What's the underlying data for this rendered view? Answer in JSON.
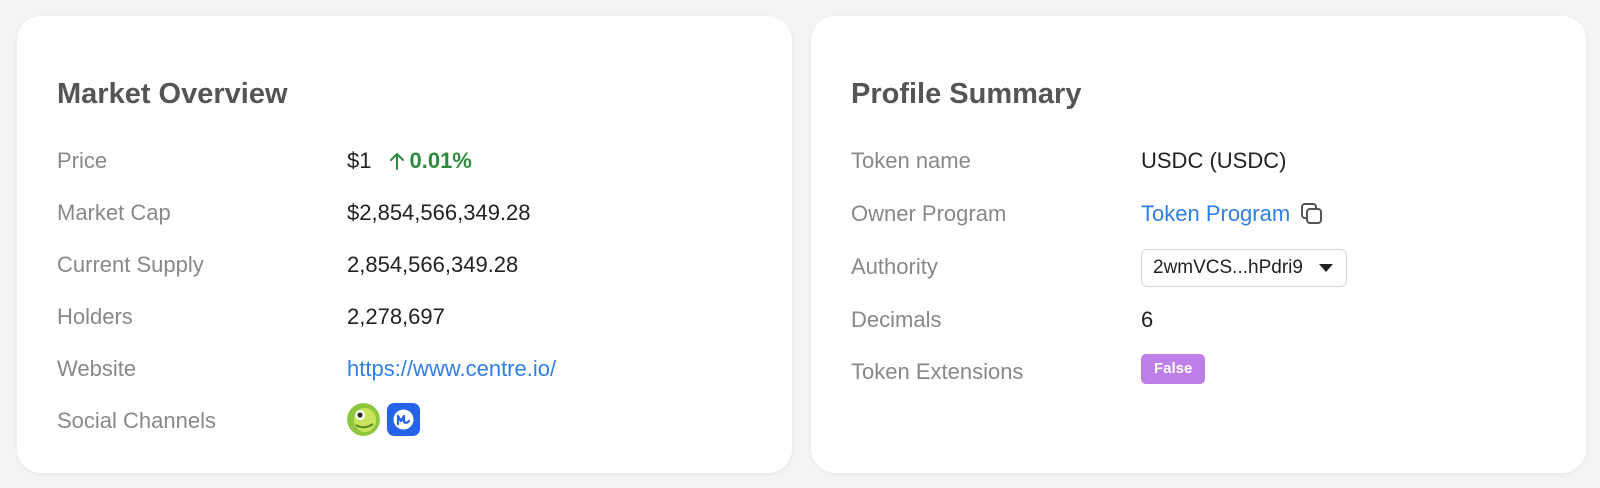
{
  "colors": {
    "background": "#f4f4f4",
    "card": "#ffffff",
    "positive": "#2e8b3e",
    "link": "#2f7fe6",
    "badge": "#be7fe8"
  },
  "market": {
    "title": "Market Overview",
    "price_label": "Price",
    "price_value": "$1",
    "price_change": "0.01%",
    "price_change_icon": "arrow-up-icon",
    "market_cap_label": "Market Cap",
    "market_cap_value": "$2,854,566,349.28",
    "supply_label": "Current Supply",
    "supply_value": "2,854,566,349.28",
    "holders_label": "Holders",
    "holders_value": "2,278,697",
    "website_label": "Website",
    "website_value": "https://www.centre.io/",
    "social_label": "Social Channels",
    "social_icons": [
      "coingecko-icon",
      "coinmarketcap-icon"
    ]
  },
  "profile": {
    "title": "Profile Summary",
    "token_name_label": "Token name",
    "token_name_value": "USDC (USDC)",
    "owner_label": "Owner Program",
    "owner_value": "Token Program",
    "authority_label": "Authority",
    "authority_value": "2wmVCS...hPdri9",
    "decimals_label": "Decimals",
    "decimals_value": "6",
    "extensions_label": "Token Extensions",
    "extensions_value": "False"
  }
}
